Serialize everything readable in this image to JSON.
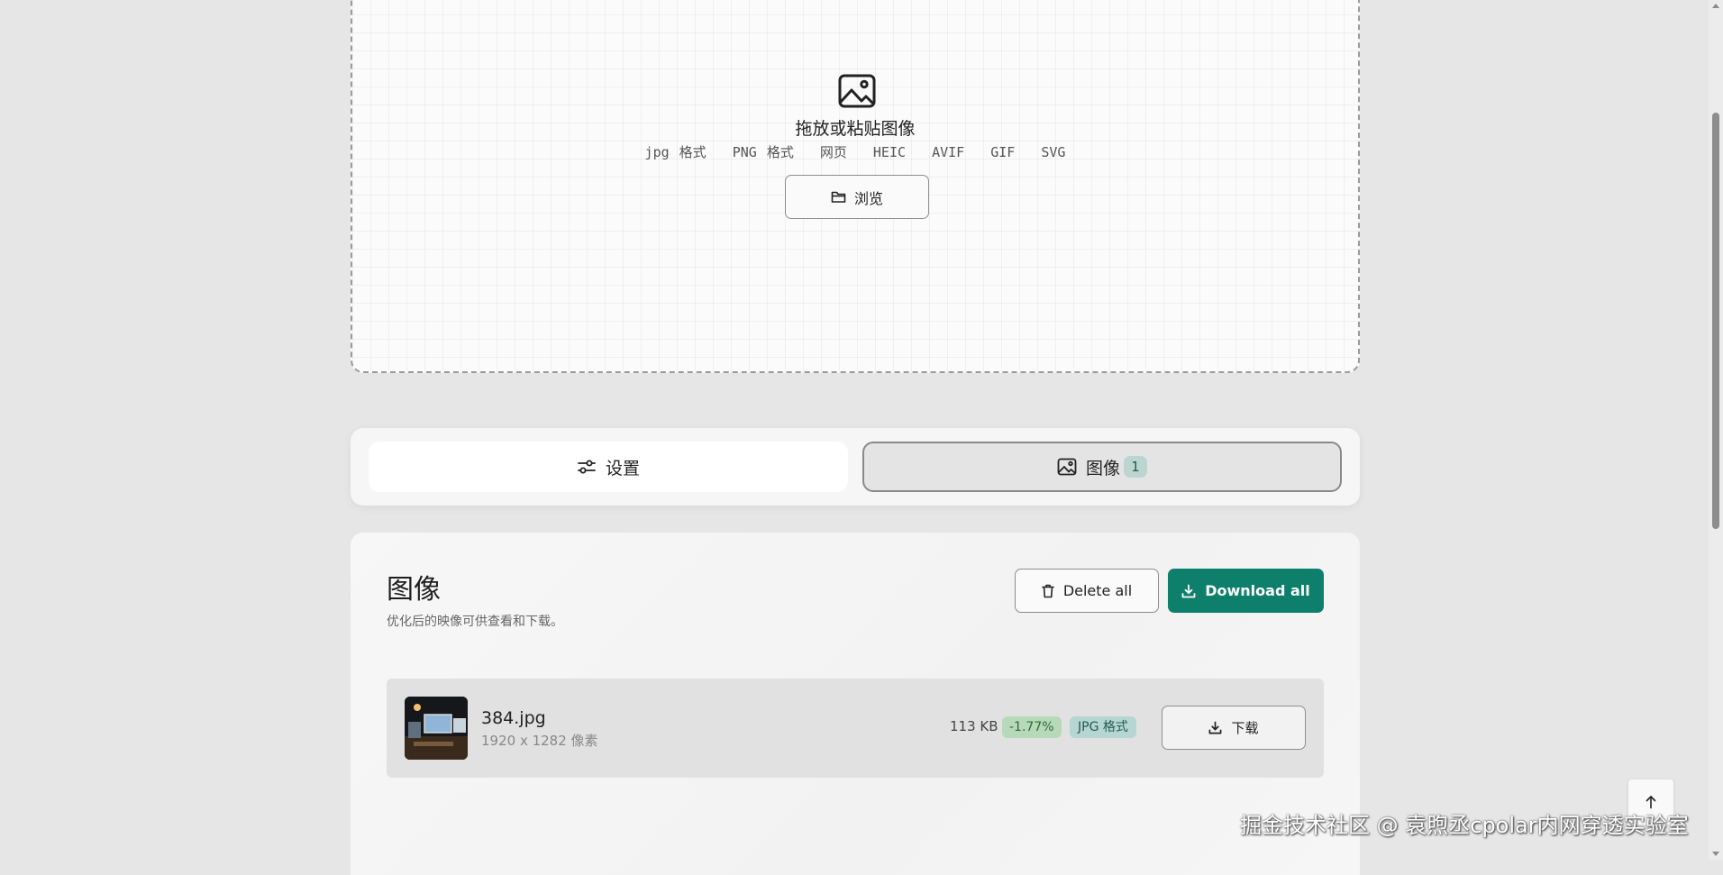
{
  "dropzone": {
    "icon": "image-icon",
    "title": "拖放或粘贴图像",
    "formats": [
      "jpg 格式",
      "PNG 格式",
      "网页",
      "HEIC",
      "AVIF",
      "GIF",
      "SVG"
    ],
    "browse_icon": "folder-icon",
    "browse_label": "浏览"
  },
  "tabs": {
    "settings": {
      "icon": "sliders-icon",
      "label": "设置"
    },
    "images": {
      "icon": "image-icon",
      "label": "图像",
      "count": "1"
    }
  },
  "images_panel": {
    "title": "图像",
    "subtitle": "优化后的映像可供查看和下载。",
    "delete_all": {
      "icon": "trash-icon",
      "label": "Delete all"
    },
    "download_all": {
      "icon": "download-icon",
      "label": "Download all"
    },
    "files": [
      {
        "name": "384.jpg",
        "dimensions": "1920 x 1282 像素",
        "size": "113 KB",
        "change": "-1.77%",
        "format": "JPG 格式",
        "download_label": "下载",
        "download_icon": "download-icon"
      }
    ]
  },
  "scroll_top": {
    "icon": "arrow-up-icon"
  },
  "watermark": "掘金技术社区 @ 袁煦丞cpolar内网穿透实验室",
  "colors": {
    "accent": "#0d7f6b",
    "background": "#e6e6e6",
    "percent_badge_bg": "#b7d9b9",
    "format_badge_bg": "#b5d6d1"
  }
}
